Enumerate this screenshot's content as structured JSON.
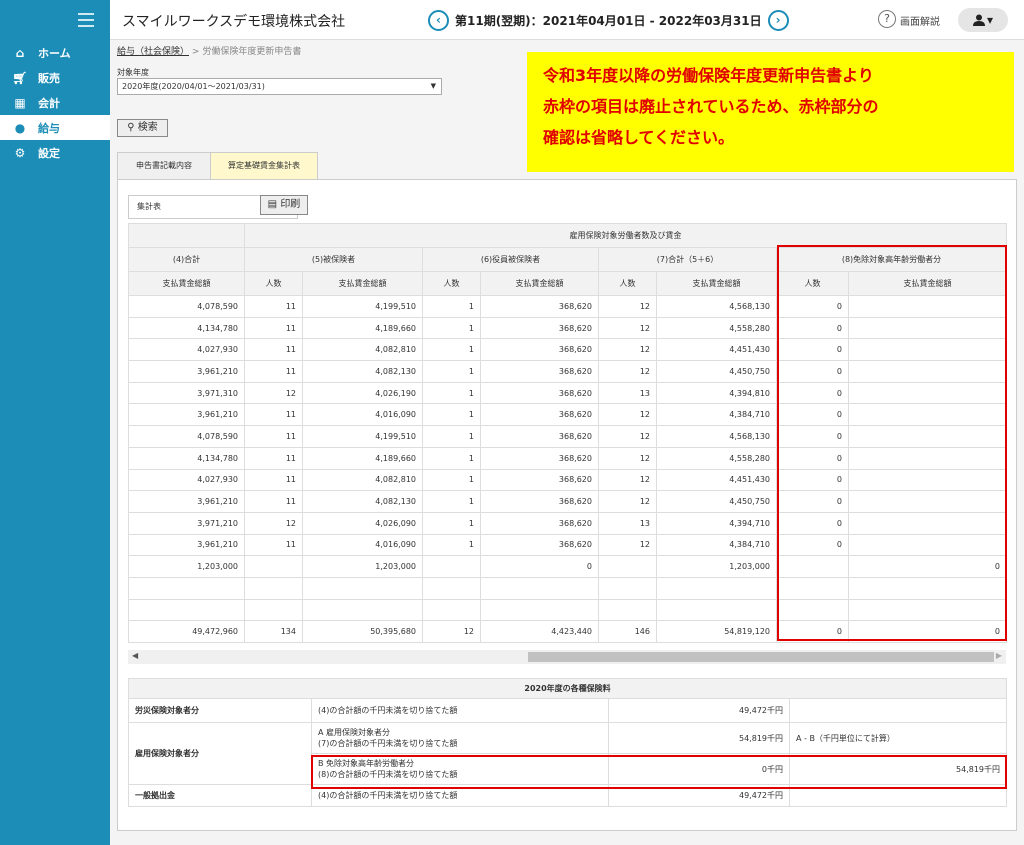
{
  "header": {
    "company": "スマイルワークスデモ環境株式会社",
    "period": "第11期(翌期)：2021年04月01日 - 2022年03月31日",
    "help": "画面解説",
    "prev": "‹",
    "next": "›",
    "user_caret": "▾"
  },
  "sidebar": {
    "items": [
      {
        "label": "ホーム",
        "icon": "home-icon"
      },
      {
        "label": "販売",
        "icon": "cart-icon"
      },
      {
        "label": "会計",
        "icon": "calculator-icon"
      },
      {
        "label": "給与",
        "icon": "money-bag-icon"
      },
      {
        "label": "設定",
        "icon": "gear-icon"
      }
    ]
  },
  "breadcrumb": {
    "link": "給与（社会保険）",
    "sep": ">",
    "current": "労働保険年度更新申告書"
  },
  "filter": {
    "label": "対象年度",
    "value": "2020年度(2020/04/01～2021/03/31)",
    "search": "検索"
  },
  "notice": {
    "lines": [
      "令和3年度以降の労働保険年度更新申告書より",
      "赤枠の項目は廃止されているため、赤枠部分の",
      "確認は省略してください。"
    ]
  },
  "tabs": [
    "申告書記載内容",
    "算定基礎賃金集計表"
  ],
  "summary": {
    "label": "集計表",
    "print": "印刷",
    "group_header": "雇用保険対象労働者数及び賃金",
    "col4": "(4)合計",
    "col5": "(5)被保険者",
    "col6": "(6)役員被保険者",
    "col7": "(7)合計（5＋6）",
    "col8": "(8)免除対象高年齢労働者分",
    "sub_pay": "支払賃金総額",
    "sub_count": "人数",
    "rows": [
      [
        "4,078,590",
        "11",
        "4,199,510",
        "1",
        "368,620",
        "12",
        "4,568,130",
        "0",
        ""
      ],
      [
        "4,134,780",
        "11",
        "4,189,660",
        "1",
        "368,620",
        "12",
        "4,558,280",
        "0",
        ""
      ],
      [
        "4,027,930",
        "11",
        "4,082,810",
        "1",
        "368,620",
        "12",
        "4,451,430",
        "0",
        ""
      ],
      [
        "3,961,210",
        "11",
        "4,082,130",
        "1",
        "368,620",
        "12",
        "4,450,750",
        "0",
        ""
      ],
      [
        "3,971,310",
        "12",
        "4,026,190",
        "1",
        "368,620",
        "13",
        "4,394,810",
        "0",
        ""
      ],
      [
        "3,961,210",
        "11",
        "4,016,090",
        "1",
        "368,620",
        "12",
        "4,384,710",
        "0",
        ""
      ],
      [
        "4,078,590",
        "11",
        "4,199,510",
        "1",
        "368,620",
        "12",
        "4,568,130",
        "0",
        ""
      ],
      [
        "4,134,780",
        "11",
        "4,189,660",
        "1",
        "368,620",
        "12",
        "4,558,280",
        "0",
        ""
      ],
      [
        "4,027,930",
        "11",
        "4,082,810",
        "1",
        "368,620",
        "12",
        "4,451,430",
        "0",
        ""
      ],
      [
        "3,961,210",
        "11",
        "4,082,130",
        "1",
        "368,620",
        "12",
        "4,450,750",
        "0",
        ""
      ],
      [
        "3,971,210",
        "12",
        "4,026,090",
        "1",
        "368,620",
        "13",
        "4,394,710",
        "0",
        ""
      ],
      [
        "3,961,210",
        "11",
        "4,016,090",
        "1",
        "368,620",
        "12",
        "4,384,710",
        "0",
        ""
      ],
      [
        "1,203,000",
        "",
        "1,203,000",
        "",
        "0",
        "",
        "1,203,000",
        "",
        "0"
      ],
      [
        "",
        "",
        "",
        "",
        "",
        "",
        "",
        "",
        ""
      ],
      [
        "",
        "",
        "",
        "",
        "",
        "",
        "",
        "",
        ""
      ],
      [
        "49,472,960",
        "134",
        "50,395,680",
        "12",
        "4,423,440",
        "146",
        "54,819,120",
        "0",
        "0"
      ]
    ]
  },
  "premium": {
    "header": "2020年度の各種保険料",
    "rosai_label": "労災保険対象者分",
    "rosai_desc": "(4)の合計額の千円未満を切り捨てた額",
    "rosai_value": "49,472千円",
    "koyo_label": "雇用保険対象者分",
    "a_desc1": "A 雇用保険対象者分",
    "a_desc2": "(7)の合計額の千円未満を切り捨てた額",
    "a_value": "54,819千円",
    "a_note": "A - B（千円単位にて計算）",
    "b_desc1": "B 免除対象高年齢労働者分",
    "b_desc2": "(8)の合計額の千円未満を切り捨てた額",
    "b_value": "0千円",
    "b_result": "54,819千円",
    "ippan_label": "一般拠出金",
    "ippan_desc": "(4)の合計額の千円未満を切り捨てた額",
    "ippan_value": "49,472千円"
  },
  "colors": {
    "brand": "#1b8db6",
    "notice_bg": "#ffff00",
    "alert_red": "#e00000"
  }
}
